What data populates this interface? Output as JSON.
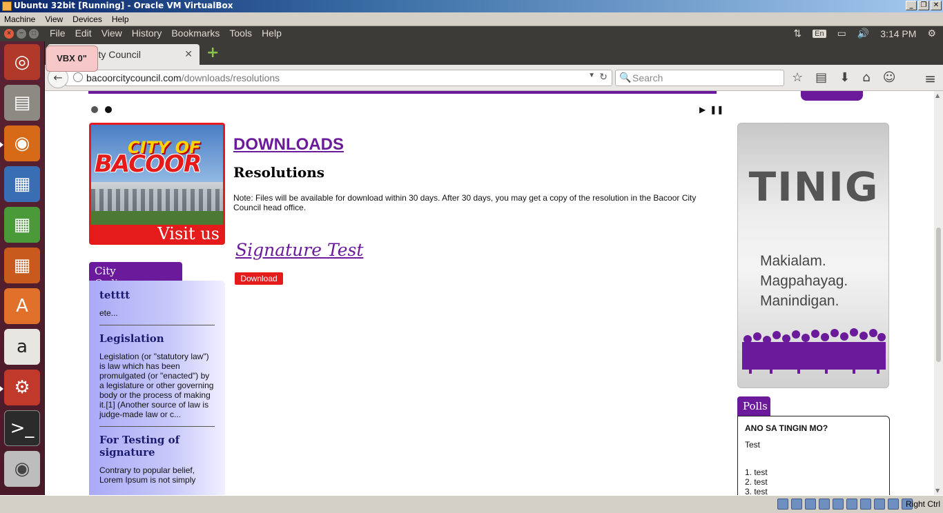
{
  "vbox": {
    "title": "Ubuntu 32bit [Running] - Oracle VM VirtualBox",
    "menu": [
      "Machine",
      "View",
      "Devices",
      "Help"
    ],
    "host_key": "Right Ctrl"
  },
  "panel": {
    "menu": [
      "File",
      "Edit",
      "View",
      "History",
      "Bookmarks",
      "Tools",
      "Help"
    ],
    "lang": "En",
    "time": "3:14 PM"
  },
  "browser": {
    "tab_title": "Bacoor City Council",
    "badge": "VBX 0\"",
    "url_domain": "bacoorcitycouncil.com",
    "url_path": "/downloads/resolutions",
    "search_placeholder": "Search"
  },
  "page": {
    "banner": {
      "line1": "CITY OF",
      "line2": "BACOOR",
      "visit": "Visit us"
    },
    "ordinances": {
      "tab": "City Ordinances",
      "items": [
        {
          "title": "tetttt",
          "text": "ete..."
        },
        {
          "title": "Legislation",
          "text": "Legislation (or \"statutory law\") is law which has been promulgated (or \"enacted\") by a legislature or other governing body or the process of making it.[1] (Another source of law is judge-made law or c..."
        },
        {
          "title": "For Testing of signature",
          "text": "Contrary to popular belief, Lorem Ipsum is not simply"
        }
      ]
    },
    "main": {
      "heading": "DOWNLOADS",
      "subheading": "Resolutions",
      "note": "Note: Files will be available for download within 30 days. After 30 days, you may get a copy of the resolution in the Bacoor City Council head office.",
      "item_title": "Signature Test",
      "download_label": "Download"
    },
    "tinig": {
      "word": "TINIG",
      "tags": [
        "Makialam.",
        "Magpahayag.",
        "Manindigan."
      ]
    },
    "polls": {
      "tab": "Polls",
      "question": "ANO SA TINGIN MO?",
      "description": "Test",
      "options": [
        "1. test",
        "2. test",
        "3. test"
      ]
    }
  },
  "colors": {
    "accent_purple": "#6a1a9a",
    "download_red": "#e51b1b",
    "launcher": "#5a2232",
    "panel": "#3c3b37"
  }
}
